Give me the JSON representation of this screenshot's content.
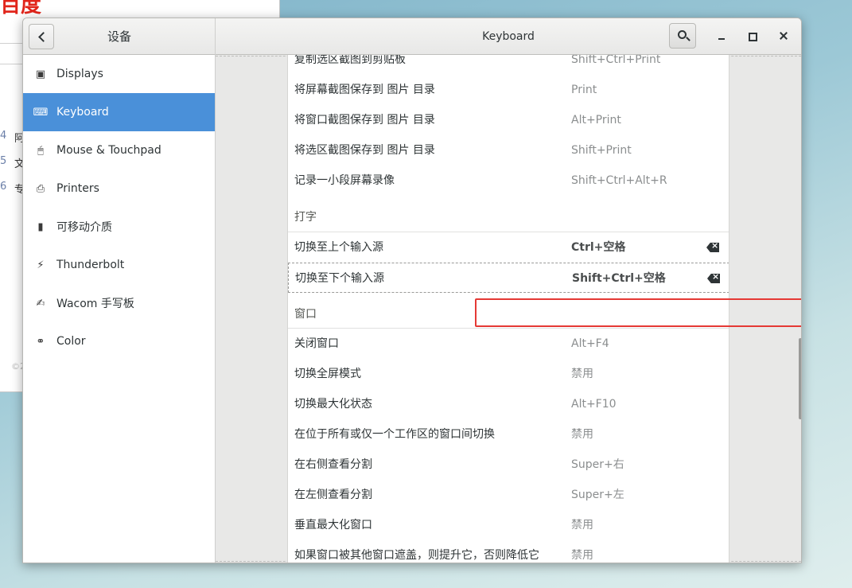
{
  "background_window": {
    "logo_text": "百度",
    "list_numbers": [
      "4",
      "5",
      "6"
    ],
    "list_chars": [
      "阿",
      "文",
      "专"
    ],
    "copyright": "©2"
  },
  "titlebar": {
    "left_title": "设备",
    "title": "Keyboard"
  },
  "sidebar": {
    "items": [
      {
        "label": "Displays",
        "icon": "display-icon"
      },
      {
        "label": "Keyboard",
        "icon": "keyboard-icon",
        "active": true
      },
      {
        "label": "Mouse & Touchpad",
        "icon": "mouse-icon"
      },
      {
        "label": "Printers",
        "icon": "printer-icon"
      },
      {
        "label": "可移动介质",
        "icon": "usb-drive-icon"
      },
      {
        "label": "Thunderbolt",
        "icon": "thunderbolt-icon"
      },
      {
        "label": "Wacom 手写板",
        "icon": "tablet-icon"
      },
      {
        "label": "Color",
        "icon": "color-icon"
      }
    ]
  },
  "shortcuts": {
    "screenshots": [
      {
        "name": "复制选区截图到剪贴板",
        "accel": "Shift+Ctrl+Print"
      },
      {
        "name": "将屏幕截图保存到 图片 目录",
        "accel": "Print"
      },
      {
        "name": "将窗口截图保存到 图片 目录",
        "accel": "Alt+Print"
      },
      {
        "name": "将选区截图保存到 图片 目录",
        "accel": "Shift+Print"
      },
      {
        "name": "记录一小段屏幕录像",
        "accel": "Shift+Ctrl+Alt+R"
      }
    ],
    "typing_title": "打字",
    "typing": [
      {
        "name": "切换至上个输入源",
        "accel": "Ctrl+空格"
      },
      {
        "name": "切换至下个输入源",
        "accel": "Shift+Ctrl+空格"
      }
    ],
    "windows_title": "窗口",
    "windows": [
      {
        "name": "关闭窗口",
        "accel": "Alt+F4"
      },
      {
        "name": "切换全屏模式",
        "accel": "禁用"
      },
      {
        "name": "切换最大化状态",
        "accel": "Alt+F10"
      },
      {
        "name": "在位于所有或仅一个工作区的窗口间切换",
        "accel": "禁用"
      },
      {
        "name": "在右侧查看分割",
        "accel": "Super+右"
      },
      {
        "name": "在左侧查看分割",
        "accel": "Super+左"
      },
      {
        "name": "垂直最大化窗口",
        "accel": "禁用"
      },
      {
        "name": "如果窗口被其他窗口遮盖，则提升它，否则降低它",
        "accel": "禁用"
      }
    ]
  },
  "colors": {
    "accent": "#4a90d9",
    "highlight_box": "#e53935"
  }
}
